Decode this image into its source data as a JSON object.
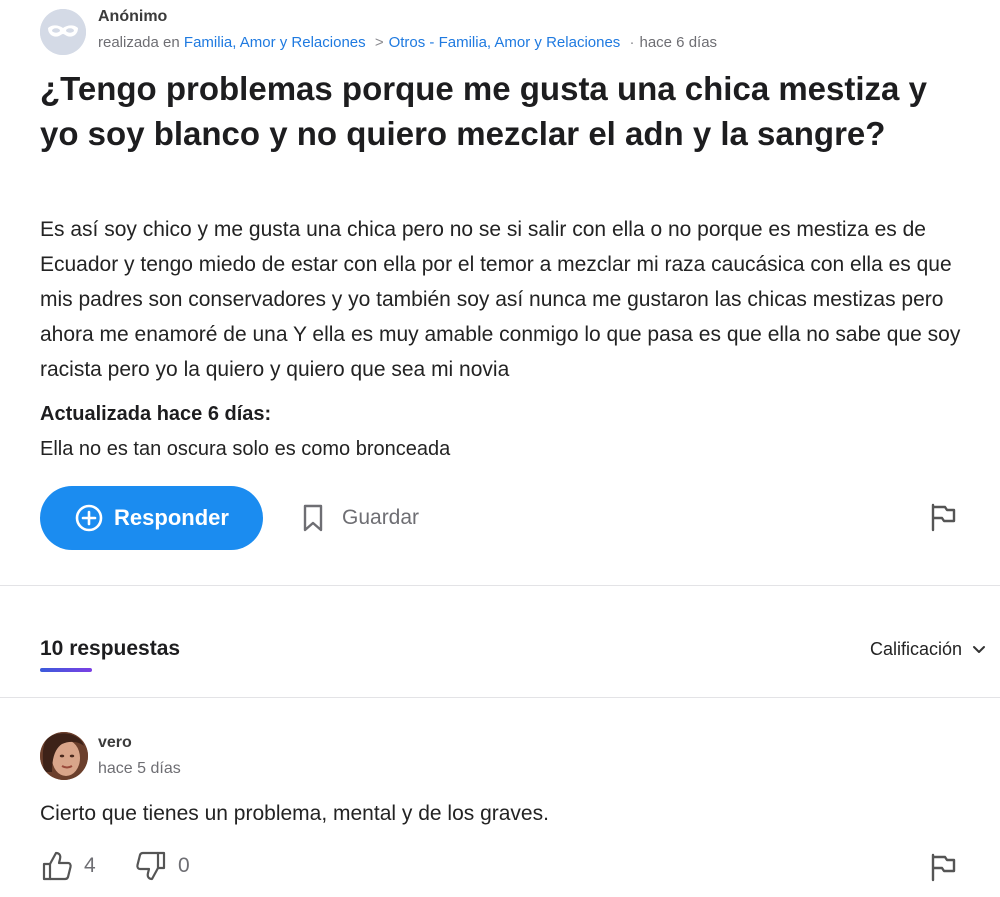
{
  "question": {
    "author": "Anónimo",
    "meta_prefix": "realizada en",
    "category": "Familia, Amor y Relaciones",
    "breadcrumb_sep": ">",
    "subcategory": "Otros - Familia, Amor y Relaciones",
    "dot": "·",
    "time": "hace 6 días",
    "title": "¿Tengo problemas porque me gusta una chica mestiza y yo soy blanco y no quiero mezclar el adn y la sangre?",
    "body": "Es así soy chico y me gusta una chica pero no se si salir con ella o no porque es mestiza es de Ecuador y tengo miedo de estar con ella por el temor a mezclar mi raza caucásica con ella es que mis padres son conservadores y yo también soy así nunca me gustaron las chicas mestizas pero ahora me enamoré de una Y ella es muy amable conmigo lo que pasa es que ella no sabe que soy racista pero yo la quiero y quiero que sea mi novia",
    "update_label": "Actualizada hace 6 días:",
    "update_text": "Ella no es tan oscura solo es como bronceada"
  },
  "actions": {
    "respond_label": "Responder",
    "save_label": "Guardar"
  },
  "answers_section": {
    "count_label": "10 respuestas",
    "sort_label": "Calificación"
  },
  "answers": [
    {
      "author": "vero",
      "time": "hace 5 días",
      "text": "Cierto que tienes un problema, mental y de los graves.",
      "likes": "4",
      "dislikes": "0"
    }
  ],
  "colors": {
    "accent": "#1b8cf0",
    "link": "#1f7ae0",
    "underline_start": "#3b5bdb",
    "underline_end": "#7b3fe4"
  },
  "icons": {
    "anon_avatar": "mask-icon",
    "respond": "plus-circle-icon",
    "save": "bookmark-icon",
    "report": "flag-icon",
    "sort": "chevron-down-icon",
    "like": "thumbs-up-icon",
    "dislike": "thumbs-down-icon"
  }
}
